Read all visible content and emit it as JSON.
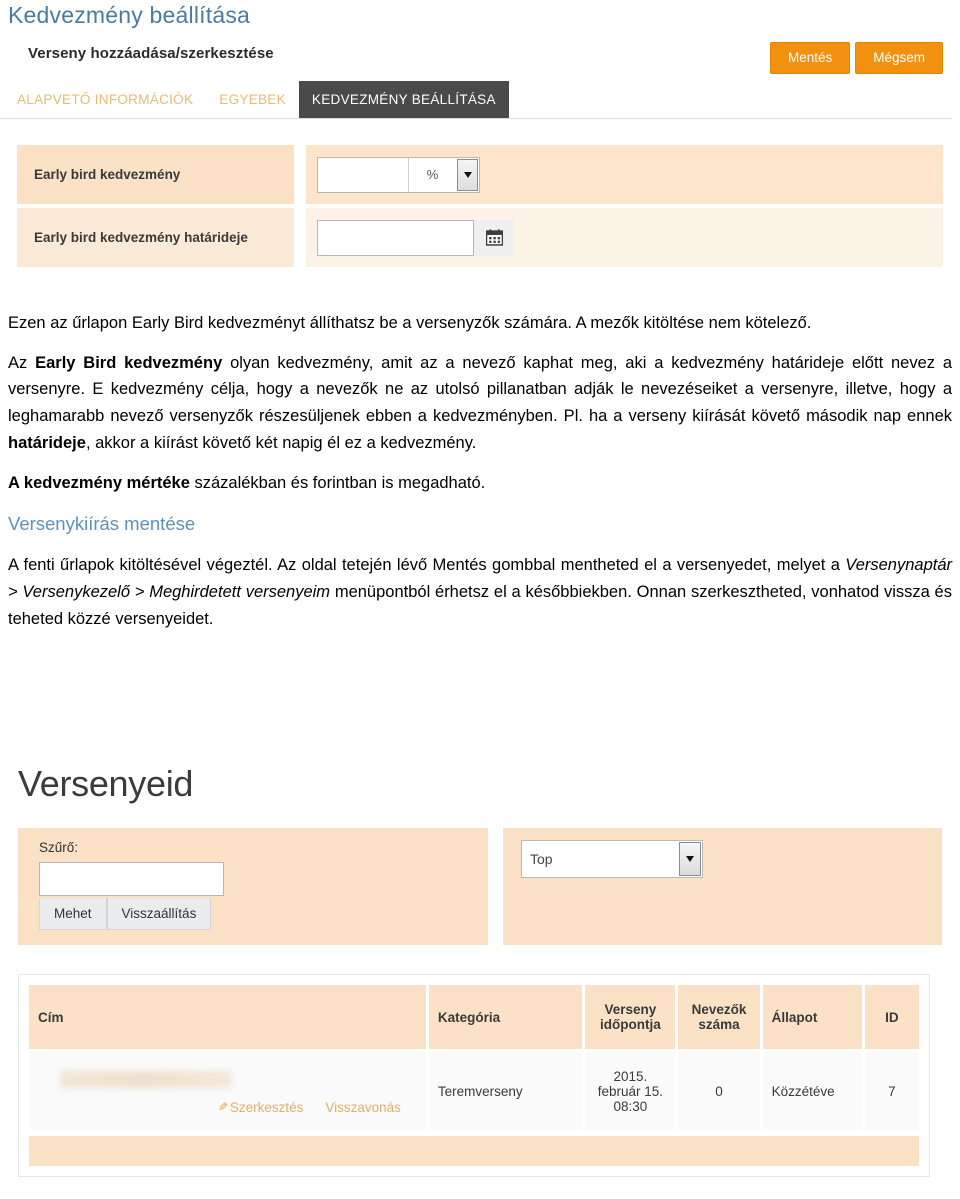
{
  "document": {
    "title": "Kedvezmény beállítása"
  },
  "form_screenshot": {
    "subtitle": "Verseny hozzáadása/szerkesztése",
    "actions": [
      {
        "name": "save",
        "label": "Mentés"
      },
      {
        "name": "cancel",
        "label": "Mégsem"
      }
    ],
    "tabs": [
      {
        "label": "ALAPVETŐ INFORMÁCIÓK",
        "active": false
      },
      {
        "label": "EGYEBEK",
        "active": false
      },
      {
        "label": "KEDVEZMÉNY BEÁLLÍTÁSA",
        "active": true
      }
    ],
    "rows": [
      {
        "label": "Early bird kedvezmény",
        "value": "",
        "placeholder": "",
        "unit": "%",
        "dropdown_icon": "chevron-down-icon"
      },
      {
        "label": "Early bird kedvezmény határideje",
        "value": "",
        "placeholder": "",
        "calendar_icon": "calendar-icon"
      }
    ]
  },
  "prose": {
    "p1_a": "Ezen az űrlapon Early Bird kedvezményt állíthatsz be a versenyzők számára. A mezők kitöltése nem kötelező.",
    "p2_a": "Az ",
    "p2_b": "Early Bird kedvezmény",
    "p2_c": " olyan kedvezmény, amit az a nevező kaphat meg, aki a kedvezmény határideje előtt nevez a versenyre. E kedvezmény célja, hogy a nevezők ne az utolsó pillanatban adják le nevezéseiket a versenyre, illetve, hogy a leghamarabb nevező versenyzők részesüljenek ebben a kedvezményben. Pl. ha a verseny kiírását követő második nap ennek ",
    "p2_d": "határideje",
    "p2_e": ", akkor a kiírást követő két napig él ez a kedvezmény.",
    "p3_a": "A kedvezmény mértéke",
    "p3_b": " százalékban és forintban is megadható.",
    "section_head": "Versenykiírás mentése",
    "p4_a": "A fenti űrlapok kitöltésével végeztél. Az oldal tetején lévő Mentés gombbal mentheted el a versenyedet, melyet a ",
    "p4_b": "Versenynaptár > Versenykezelő > Meghirdetett versenyeim",
    "p4_c": " menüpontból érhetsz el a későbbiekben. Onnan szerkesztheted, vonhatod vissza és teheted közzé versenyeidet."
  },
  "list_screenshot": {
    "title": "Versenyeid",
    "filter": {
      "label": "Szűrő:",
      "value": "",
      "placeholder": "",
      "submit_label": "Mehet",
      "reset_label": "Visszaállítás"
    },
    "sort": {
      "selected": "Top",
      "dropdown_icon": "chevron-down-icon"
    },
    "table": {
      "columns": [
        "Cím",
        "Kategória",
        "Verseny időpontja",
        "Nevezők száma",
        "Állapot",
        "ID"
      ],
      "rows": [
        {
          "cim": "",
          "cim_redacted": true,
          "edit_label": "Szerkesztés",
          "edit_icon": "pencil-icon",
          "withdraw_label": "Visszavonás",
          "kategoria": "Teremverseny",
          "idopontja": "2015. február 15. 08:30",
          "nevezok_szama": "0",
          "allapot": "Közzétéve",
          "id": "7"
        }
      ]
    }
  },
  "colors": {
    "title_blue": "#4a7ba0",
    "accent_orange": "#f2910f",
    "tab_inactive": "#e8bb75",
    "tab_active_bg": "#4a4a4a",
    "panel_peach": "#fbe2c6",
    "panel_peach_light": "#fdf2e6",
    "link_gold": "#e0b06a"
  }
}
